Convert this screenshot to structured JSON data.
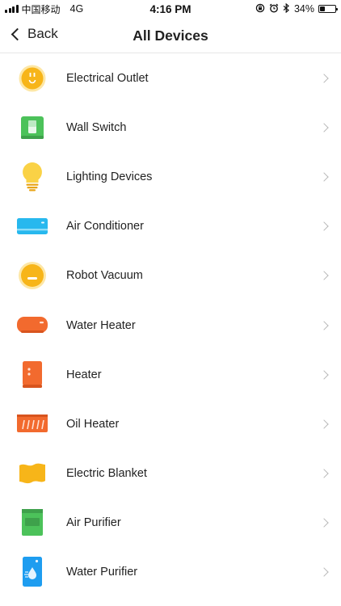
{
  "status_bar": {
    "carrier": "中国移动",
    "network": "4G",
    "time": "4:16 PM",
    "battery_text": "34%",
    "battery_level": 0.34,
    "icons": [
      "signal-icon",
      "rotation-lock-icon",
      "alarm-icon",
      "bluetooth-icon",
      "battery-icon"
    ]
  },
  "nav": {
    "back_label": "Back",
    "title": "All Devices"
  },
  "devices": [
    {
      "label": "Electrical Outlet",
      "icon": "electrical-outlet-icon",
      "color": "#F7B519"
    },
    {
      "label": "Wall Switch",
      "icon": "wall-switch-icon",
      "color": "#4CC25A"
    },
    {
      "label": "Lighting Devices",
      "icon": "light-bulb-icon",
      "color": "#FAD246"
    },
    {
      "label": "Air Conditioner",
      "icon": "air-conditioner-icon",
      "color": "#27B8EE"
    },
    {
      "label": "Robot Vacuum",
      "icon": "robot-vacuum-icon",
      "color": "#F7B519"
    },
    {
      "label": "Water Heater",
      "icon": "water-heater-icon",
      "color": "#F26A2E"
    },
    {
      "label": "Heater",
      "icon": "heater-icon",
      "color": "#F26A2E"
    },
    {
      "label": "Oil Heater",
      "icon": "oil-heater-icon",
      "color": "#F26A2E"
    },
    {
      "label": "Electric Blanket",
      "icon": "electric-blanket-icon",
      "color": "#F7B519"
    },
    {
      "label": "Air Purifier",
      "icon": "air-purifier-icon",
      "color": "#4CC25A"
    },
    {
      "label": "Water Purifier",
      "icon": "water-purifier-icon",
      "color": "#1E9DF0"
    }
  ]
}
